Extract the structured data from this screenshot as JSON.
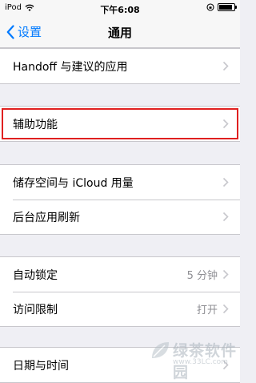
{
  "status_bar": {
    "carrier": "iPod",
    "time": "下午6:08",
    "icons": [
      "wifi-icon",
      "rotation-lock-icon",
      "battery-icon"
    ],
    "battery_level": 0.9
  },
  "nav": {
    "back_label": "设置",
    "title": "通用"
  },
  "groups": [
    {
      "rows": [
        {
          "label": "Handoff 与建议的应用",
          "value": ""
        }
      ]
    },
    {
      "rows": [
        {
          "label": "辅助功能",
          "value": "",
          "highlighted": true
        }
      ]
    },
    {
      "rows": [
        {
          "label": "储存空间与 iCloud 用量",
          "value": ""
        },
        {
          "label": "后台应用刷新",
          "value": ""
        }
      ]
    },
    {
      "rows": [
        {
          "label": "自动锁定",
          "value": "5 分钟"
        },
        {
          "label": "访问限制",
          "value": "打开"
        }
      ]
    },
    {
      "rows": [
        {
          "label": "日期与时间",
          "value": ""
        }
      ]
    }
  ],
  "colors": {
    "accent": "#007aff",
    "highlight": "#e02020",
    "background": "#efeff4"
  },
  "watermark": {
    "text": "绿茶软件园",
    "sub": "www.33LC.com"
  }
}
